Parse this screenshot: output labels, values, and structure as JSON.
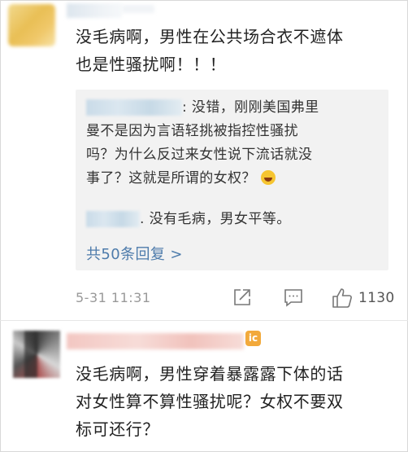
{
  "comments": [
    {
      "text_line1": "没毛病啊，男性在公共场合衣不遮体",
      "text_line2": "也是性骚扰啊！！！",
      "replies": [
        {
          "text_line1": ": 没错，刚刚美国弗里",
          "text_line2": "曼不是因为言语轻挑被指控性骚扰",
          "text_line3": "吗？为什么反过来女性说下流话就没",
          "text_line4": "事了？这就是所谓的女权？",
          "emoji": "laugh-emoji"
        },
        {
          "text": ". 没有毛病，男女平等。"
        }
      ],
      "more_replies": "共50条回复 >",
      "timestamp": "5-31 11:31",
      "like_count": "1130"
    },
    {
      "text_line1": "没毛病啊，男性穿着暴露露下体的话",
      "text_line2": "对女性算不算性骚扰呢？女权不要双",
      "text_line3": "标可还行？",
      "badge": "ic"
    }
  ],
  "colors": {
    "link": "#4d7bab",
    "meta": "#999999",
    "quote_bg": "#f2f2f2"
  }
}
